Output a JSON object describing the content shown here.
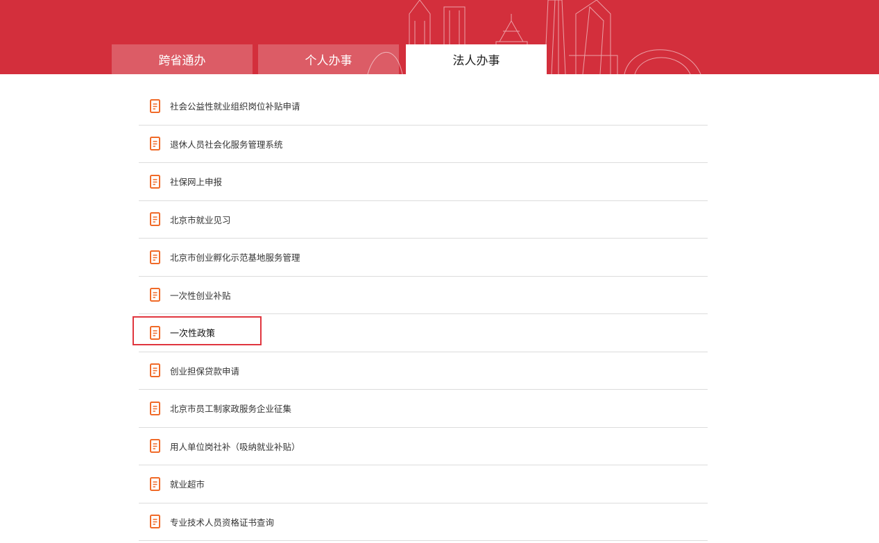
{
  "tabs": [
    {
      "label": "跨省通办",
      "active": false
    },
    {
      "label": "个人办事",
      "active": false
    },
    {
      "label": "法人办事",
      "active": true
    }
  ],
  "theme": {
    "header_color": "#d32f3c",
    "icon_color": "#f06a28",
    "highlight_color": "#e0353e"
  },
  "icons": {
    "item_icon": "document-icon"
  },
  "services": [
    {
      "label": "社会公益性就业组织岗位补贴申请"
    },
    {
      "label": "退休人员社会化服务管理系统"
    },
    {
      "label": "社保网上申报"
    },
    {
      "label": "北京市就业见习"
    },
    {
      "label": "北京市创业孵化示范基地服务管理"
    },
    {
      "label": "一次性创业补贴"
    },
    {
      "label": "一次性政策",
      "highlighted": true
    },
    {
      "label": "创业担保贷款申请"
    },
    {
      "label": "北京市员工制家政服务企业征集"
    },
    {
      "label": "用人单位岗社补（吸纳就业补贴）"
    },
    {
      "label": "就业超市"
    },
    {
      "label": "专业技术人员资格证书查询"
    }
  ]
}
